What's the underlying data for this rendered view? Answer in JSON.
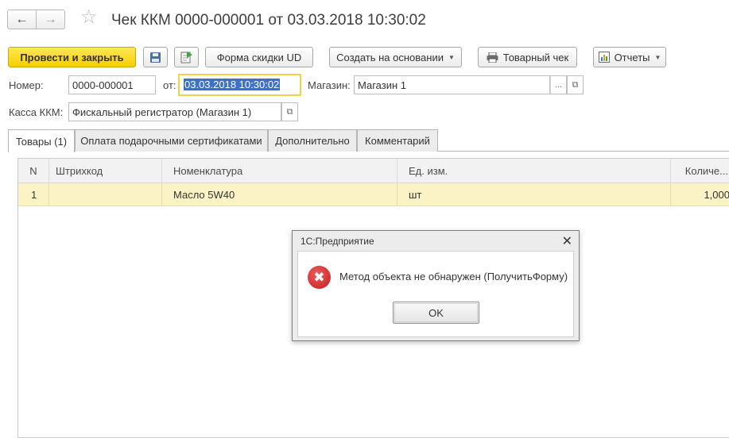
{
  "header": {
    "title": "Чек ККМ 0000-000001 от 03.03.2018 10:30:02",
    "back_icon": "arrow-left-icon",
    "forward_icon": "arrow-right-icon",
    "favorite_icon": "star-icon"
  },
  "toolbar": {
    "post_and_close": "Провести и закрыть",
    "discount_form": "Форма скидки UD",
    "create_based_on": "Создать на основании",
    "goods_receipt": "Товарный чек",
    "reports": "Отчеты"
  },
  "form": {
    "number_label": "Номер:",
    "number_value": "0000-000001",
    "date_label": "от:",
    "date_value": "03.03.2018 10:30:02",
    "store_label": "Магазин:",
    "store_value": "Магазин 1",
    "register_label": "Касса ККМ:",
    "register_value": "Фискальный регистратор (Магазин 1)"
  },
  "tabs": [
    {
      "label": "Товары (1)"
    },
    {
      "label": "Оплата подарочными сертификатами"
    },
    {
      "label": "Дополнительно"
    },
    {
      "label": "Комментарий"
    }
  ],
  "table": {
    "columns": [
      "N",
      "Штрихкод",
      "Номенклатура",
      "Ед. изм.",
      "Количе..."
    ],
    "rows": [
      {
        "n": "1",
        "barcode": "",
        "item": "Масло 5W40",
        "unit": "шт",
        "qty": "1,000"
      }
    ]
  },
  "dialog": {
    "title": "1С:Предприятие",
    "message": "Метод объекта не обнаружен (ПолучитьФорму)",
    "ok": "OK"
  },
  "colors": {
    "accent_yellow": "#f5cf00",
    "selected_row": "#fbf3c6",
    "error_red": "#d32f2f",
    "selection_blue": "#3c72c8"
  }
}
